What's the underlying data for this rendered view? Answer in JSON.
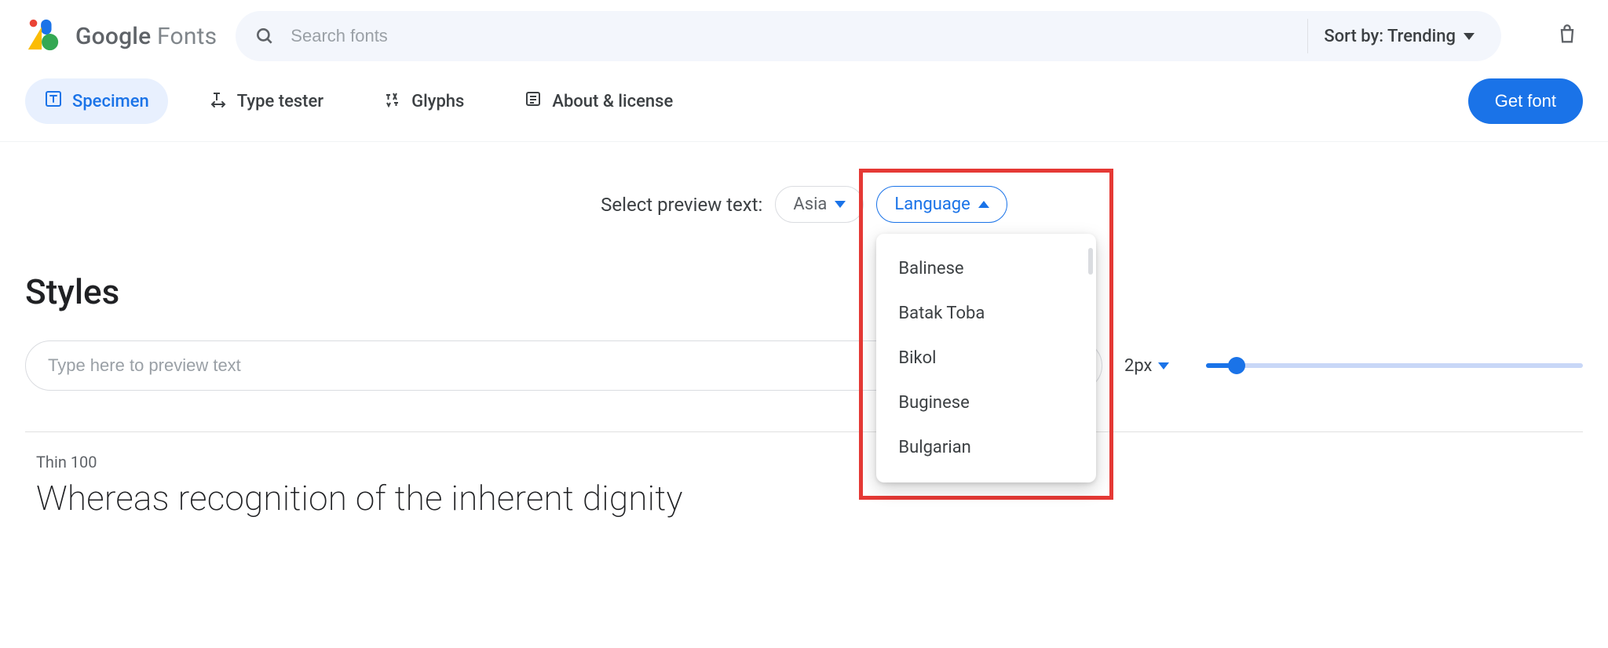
{
  "brand": {
    "google": "Google",
    "fonts": " Fonts"
  },
  "search": {
    "placeholder": "Search fonts"
  },
  "sort": {
    "label": "Sort by: Trending"
  },
  "tabs": {
    "specimen": "Specimen",
    "tester": "Type tester",
    "glyphs": "Glyphs",
    "about": "About & license"
  },
  "cta": {
    "get_font": "Get font"
  },
  "preview": {
    "select_label": "Select preview text:",
    "region_chip": "Asia",
    "lang_chip": "Language",
    "lang_options": [
      "Balinese",
      "Batak Toba",
      "Bikol",
      "Buginese",
      "Bulgarian"
    ]
  },
  "styles": {
    "heading": "Styles",
    "input_placeholder": "Type here to preview text",
    "size_label": "2px",
    "weight_label": "Thin 100",
    "specimen_text": "Whereas recognition of the inherent dignity"
  }
}
